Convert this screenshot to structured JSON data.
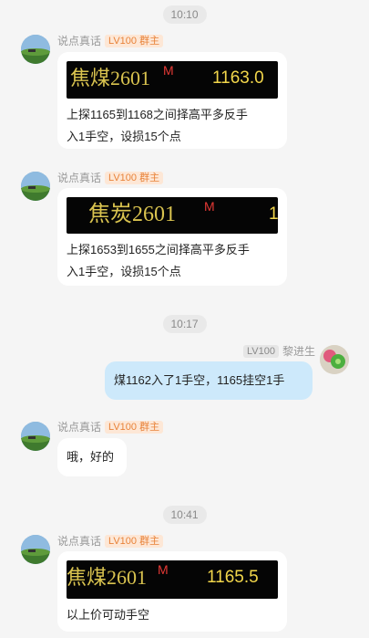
{
  "times": [
    "10:10",
    "10:17",
    "10:41"
  ],
  "messages": [
    {
      "sender": "说点真话",
      "badge": "LV100 群主",
      "ticker": {
        "name": "焦煤2601",
        "flag": "M",
        "price": "1163.0"
      },
      "text": "上探1165到1168之间择高平多反手\n入1手空，设损15个点"
    },
    {
      "sender": "说点真话",
      "badge": "LV100 群主",
      "ticker": {
        "name": "焦炭2601",
        "flag": "M",
        "price": "1"
      },
      "text": "上探1653到1655之间择高平多反手\n入1手空，设损15个点"
    },
    {
      "sender": "黎进生",
      "badge": "LV100",
      "text": "煤1162入了1手空，1165挂空1手"
    },
    {
      "sender": "说点真话",
      "badge": "LV100 群主",
      "text": "哦，好的"
    },
    {
      "sender": "说点真话",
      "badge": "LV100 群主",
      "ticker": {
        "name": "焦煤2601",
        "flag": "M",
        "price": "1165.5"
      },
      "text": "以上价可动手空"
    }
  ]
}
